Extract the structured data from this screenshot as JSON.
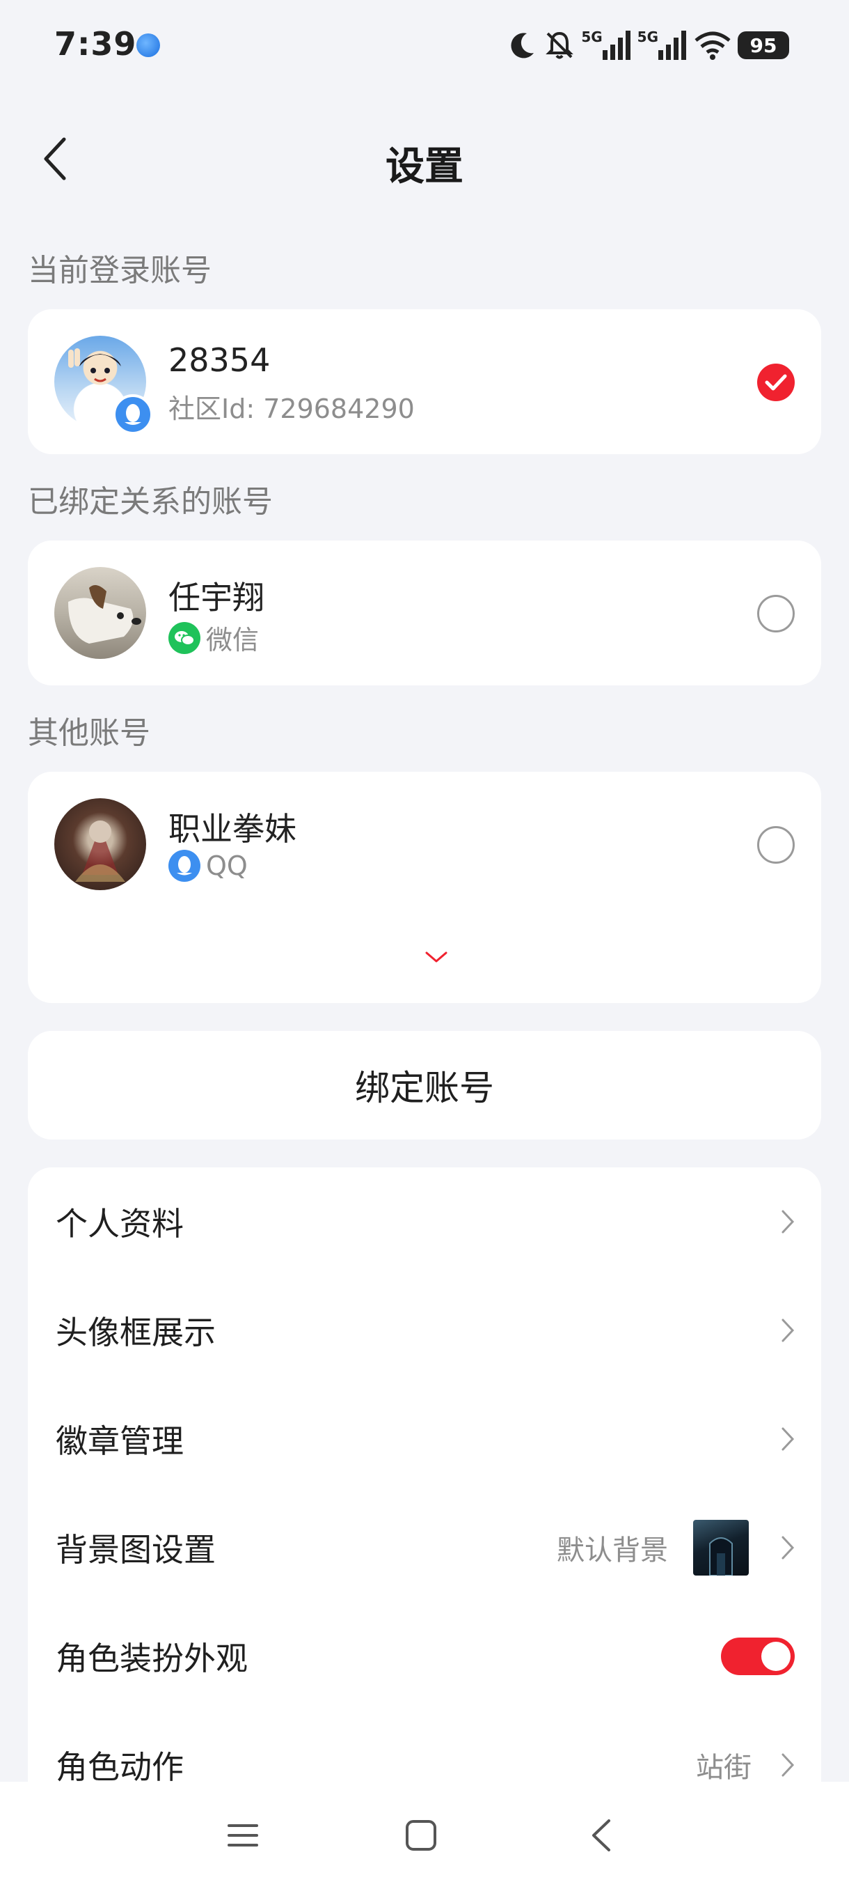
{
  "status_bar": {
    "time": "7:39",
    "battery": "95",
    "net1": "5G",
    "net2": "5G"
  },
  "header": {
    "title": "设置",
    "back_icon": "chevron-left-icon"
  },
  "sections": {
    "current": "当前登录账号",
    "bound": "已绑定关系的账号",
    "other": "其他账号"
  },
  "current_account": {
    "name": "28354",
    "sub": "社区Id: 729684290",
    "selected": true
  },
  "bound_account": {
    "name": "任宇翔",
    "platform": "微信",
    "selected": false
  },
  "other_account": {
    "name": "职业拳妹",
    "platform": "QQ",
    "selected": false
  },
  "bind_button": "绑定账号",
  "menu": {
    "profile": "个人资料",
    "frame": "头像框展示",
    "badge": "徽章管理",
    "background": "背景图设置",
    "background_value": "默认背景",
    "appearance": "角色装扮外观",
    "appearance_on": true,
    "action": "角色动作",
    "action_value": "站街"
  },
  "colors": {
    "accent": "#f0222f",
    "wechat": "#1fc25a",
    "qq": "#3d8ff0",
    "bg": "#f3f4f8"
  }
}
